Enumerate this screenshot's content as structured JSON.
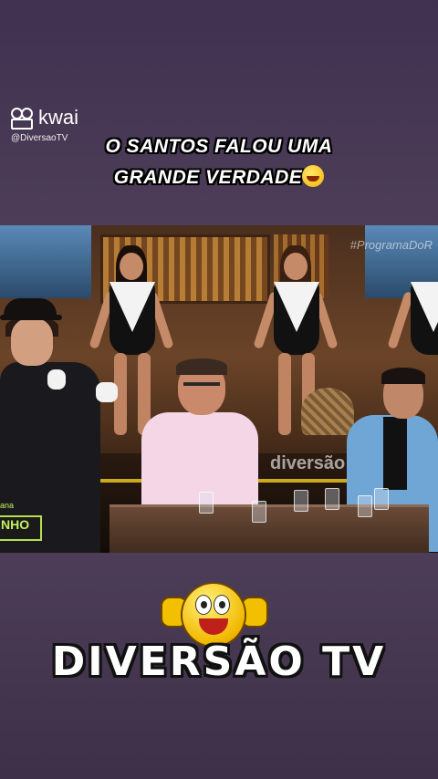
{
  "app": {
    "name": "kwai",
    "handle": "@DiversaoTV"
  },
  "caption": {
    "line1": "O SANTOS FALOU UMA",
    "line2": "GRANDE VERDADE",
    "emoji": "grinning-sweat-icon"
  },
  "video": {
    "watermark_top": "#ProgramaDoR",
    "watermark_mid": "diversão",
    "show_badge_top": "ana",
    "show_badge": "NHO"
  },
  "brand": {
    "name": "DIVERSÃO TV",
    "mascot": "thumbs-up-smiley-icon"
  },
  "colors": {
    "background": "#4a3a55",
    "badge_accent": "#b4e04a"
  }
}
